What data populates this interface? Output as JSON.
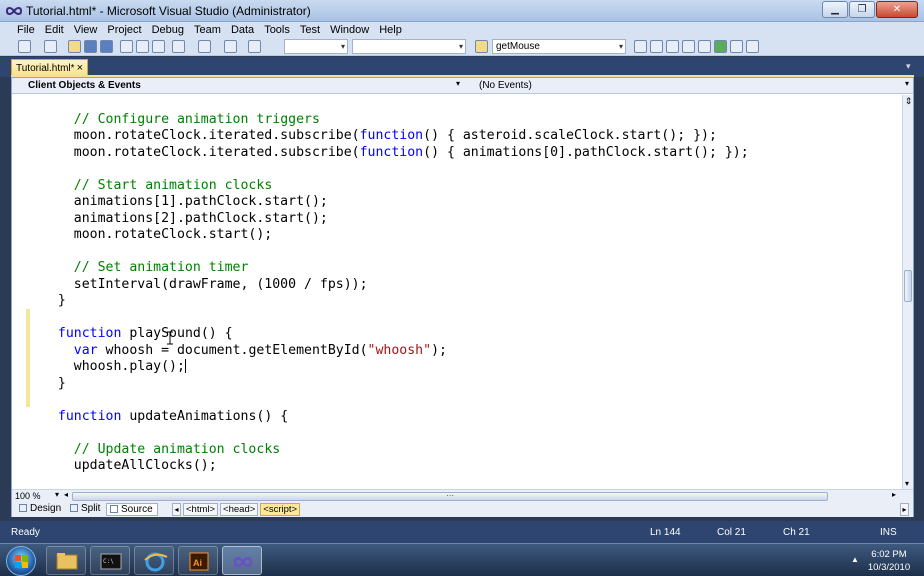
{
  "window": {
    "title": "Tutorial.html* - Microsoft Visual Studio (Administrator)"
  },
  "menu": [
    "File",
    "Edit",
    "View",
    "Project",
    "Debug",
    "Team",
    "Data",
    "Tools",
    "Test",
    "Window",
    "Help"
  ],
  "toolbar": {
    "find_combo_value": "getMouse"
  },
  "tabs": [
    {
      "label": "Tutorial.html*",
      "close": "×"
    }
  ],
  "navbar": {
    "left": "Client Objects & Events",
    "right": "(No Events)"
  },
  "code": [
    "",
    "    // Configure animation triggers",
    "    moon.rotateClock.iterated.subscribe(function() { asteroid.scaleClock.start(); });",
    "    moon.rotateClock.iterated.subscribe(function() { animations[0].pathClock.start(); });",
    "",
    "    // Start animation clocks",
    "    animations[1].pathClock.start();",
    "    animations[2].pathClock.start();",
    "    moon.rotateClock.start();",
    "",
    "    // Set animation timer",
    "    setInterval(drawFrame, (1000 / fps));",
    "  }",
    "",
    "  function playSound() {",
    "    var whoosh = document.getElementById(\"whoosh\");",
    "    whoosh.play();",
    "  }",
    "",
    "  function updateAnimations() {",
    "",
    "    // Update animation clocks",
    "    updateAllClocks();",
    ""
  ],
  "zoom": "100 %",
  "views": {
    "design": "Design",
    "split": "Split",
    "source": "Source"
  },
  "breadcrumbs": [
    "<html>",
    "<head>",
    "<script>"
  ],
  "status": {
    "ready": "Ready",
    "ln": "Ln 144",
    "col": "Col 21",
    "ch": "Ch 21",
    "mode": "INS"
  },
  "clock": {
    "time": "6:02 PM",
    "date": "10/3/2010"
  },
  "colors": {
    "keyword": "#0000ff",
    "comment": "#008000",
    "string": "#a31515",
    "chrome": "#2e4570"
  }
}
